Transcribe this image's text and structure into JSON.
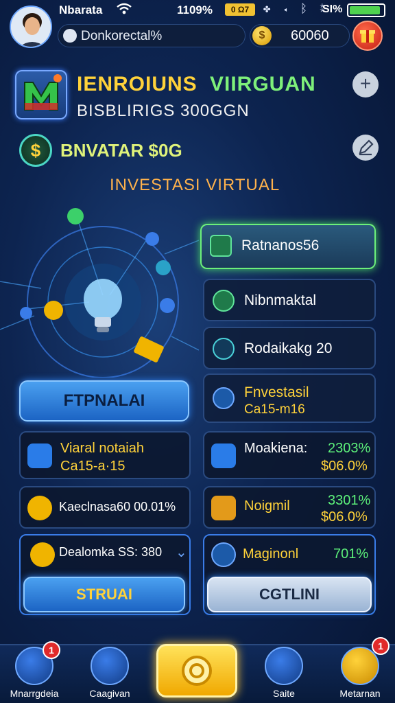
{
  "status_bar": {
    "carrier": "Nbarata",
    "battery_percent": "1109%",
    "badge": "0 Ω7",
    "battery_percent_2": "SI%",
    "battery_level": 0.92
  },
  "profile": {
    "search_text": "Donkorectal%",
    "coins": "60060"
  },
  "header": {
    "app_name_part1": "IENROIUNS",
    "app_name_part2": "VIIRGUAN",
    "app_subtitle": "BISBLIRIGS 300GGN",
    "balance": "BNVATAR $0G",
    "section_title": "INVESTASI  VIRTUAL"
  },
  "menu": [
    {
      "label": "Ratnanos56",
      "sub": ""
    },
    {
      "label": "Nibnmaktal",
      "sub": ""
    },
    {
      "label": "Rodaikakg 20",
      "sub": ""
    },
    {
      "label": "Fnvestasil",
      "sub": "Ca15-m16"
    }
  ],
  "left_button": {
    "label": "FTPNALAI"
  },
  "cards": {
    "c1_line1": "Viaral notaiah",
    "c1_line2": "Ca15-a·15",
    "c2_label": "Moakiena:",
    "c2_pct": "2303%",
    "c2_val": "$06.0%",
    "c3_text": "Kaeclnasa60 00.01%",
    "c4_label": "Noigmil",
    "c4_pct": "3301%",
    "c4_val": "$06.0%",
    "c5_text": "Dealomka SS: 380",
    "c6_label": "Maginonl",
    "c6_pct": "701%"
  },
  "actions": {
    "left": "STRUAI",
    "right": "CGTLINI"
  },
  "nav": [
    {
      "label": "Mnarrgdeia",
      "badge": "1"
    },
    {
      "label": "Caagivan"
    },
    {
      "label": ""
    },
    {
      "label": "Saite"
    },
    {
      "label": "Metarnan",
      "badge": "1"
    }
  ]
}
